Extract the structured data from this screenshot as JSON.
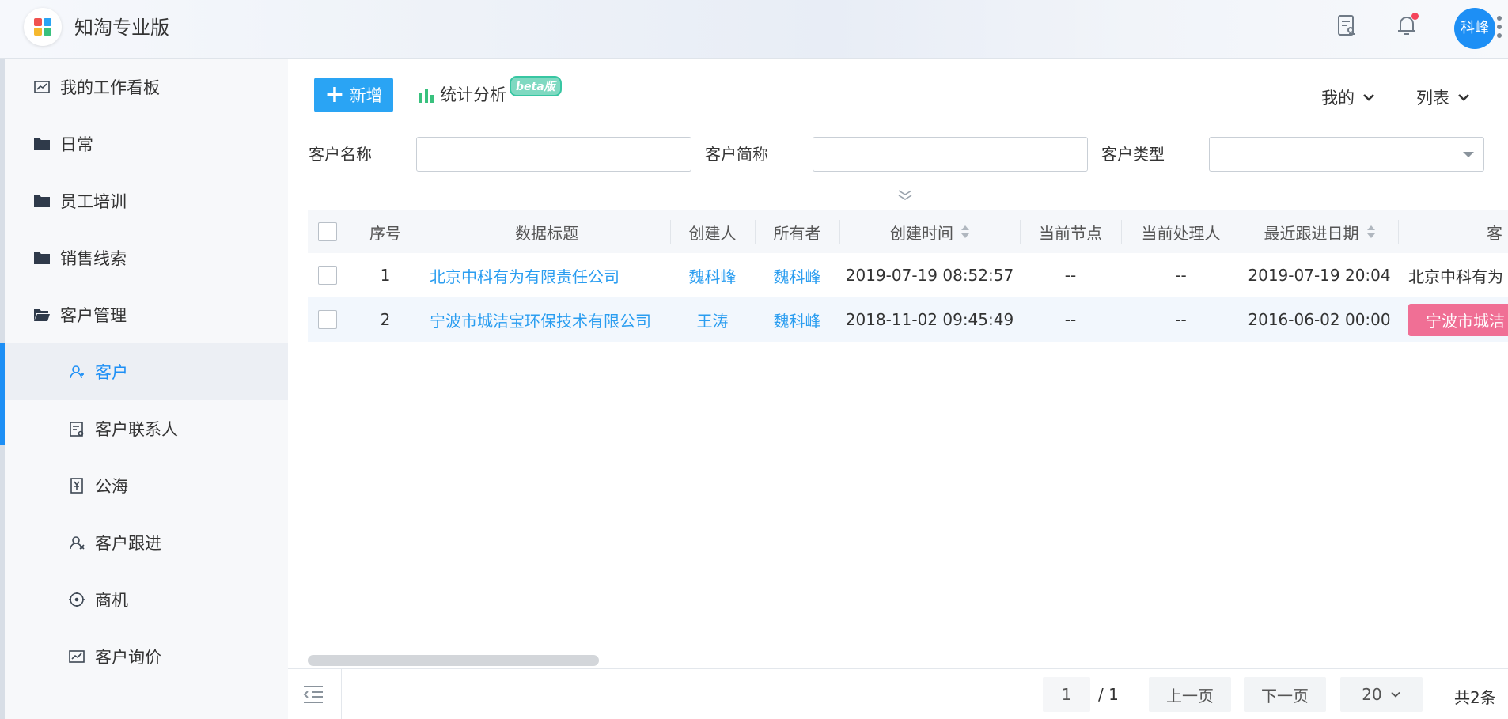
{
  "header": {
    "app_title": "知淘专业版",
    "avatar_text": "科峰",
    "icons": [
      "approval-doc-icon",
      "bell-icon",
      "more-vertical-icon"
    ]
  },
  "sidebar": {
    "items": [
      {
        "label": "我的工作看板",
        "icon": "dashboard-chart-icon",
        "level": 0
      },
      {
        "label": "日常",
        "icon": "folder-icon",
        "level": 0
      },
      {
        "label": "员工培训",
        "icon": "folder-icon",
        "level": 0
      },
      {
        "label": "销售线索",
        "icon": "folder-icon",
        "level": 0
      },
      {
        "label": "客户管理",
        "icon": "folder-open-icon",
        "level": 0
      },
      {
        "label": "客户",
        "icon": "user-icon",
        "level": 1,
        "active": true
      },
      {
        "label": "客户联系人",
        "icon": "contact-card-icon",
        "level": 1
      },
      {
        "label": "公海",
        "icon": "yuan-doc-icon",
        "level": 1
      },
      {
        "label": "客户跟进",
        "icon": "user-follow-icon",
        "level": 1
      },
      {
        "label": "商机",
        "icon": "target-icon",
        "level": 1
      },
      {
        "label": "客户询价",
        "icon": "chart-line-icon",
        "level": 1
      }
    ]
  },
  "toolbar": {
    "new_label": "新增",
    "stats_label": "统计分析",
    "beta_label": "beta版",
    "mine_label": "我的",
    "view_label": "列表"
  },
  "filters": {
    "name_label": "客户名称",
    "name_value": "",
    "short_label": "客户简称",
    "short_value": "",
    "type_label": "客户类型",
    "type_value": ""
  },
  "table": {
    "headers": {
      "index": "序号",
      "title": "数据标题",
      "creator": "创建人",
      "owner": "所有者",
      "created": "创建时间",
      "node": "当前节点",
      "handler": "当前处理人",
      "follow": "最近跟进日期",
      "customer": "客"
    },
    "rows": [
      {
        "index": "1",
        "title": "北京中科有为有限责任公司",
        "creator": "魏科峰",
        "owner": "魏科峰",
        "created": "2019-07-19 08:52:57",
        "node": "--",
        "handler": "--",
        "follow": "2019-07-19 20:04",
        "customer": "北京中科有为"
      },
      {
        "index": "2",
        "title": "宁波市城洁宝环保技术有限公司",
        "creator": "王涛",
        "owner": "魏科峰",
        "created": "2018-11-02 09:45:49",
        "node": "--",
        "handler": "--",
        "follow": "2016-06-02 00:00",
        "customer": "宁波市城洁"
      }
    ]
  },
  "pager": {
    "current_page": "1",
    "total_pages": "/ 1",
    "prev_label": "上一页",
    "next_label": "下一页",
    "page_size": "20",
    "total_label": "共2条"
  },
  "colors": {
    "primary": "#2aa4f4",
    "link": "#2a9df0",
    "tag": "#f06f95",
    "active_nav": "#1d8ff5"
  }
}
